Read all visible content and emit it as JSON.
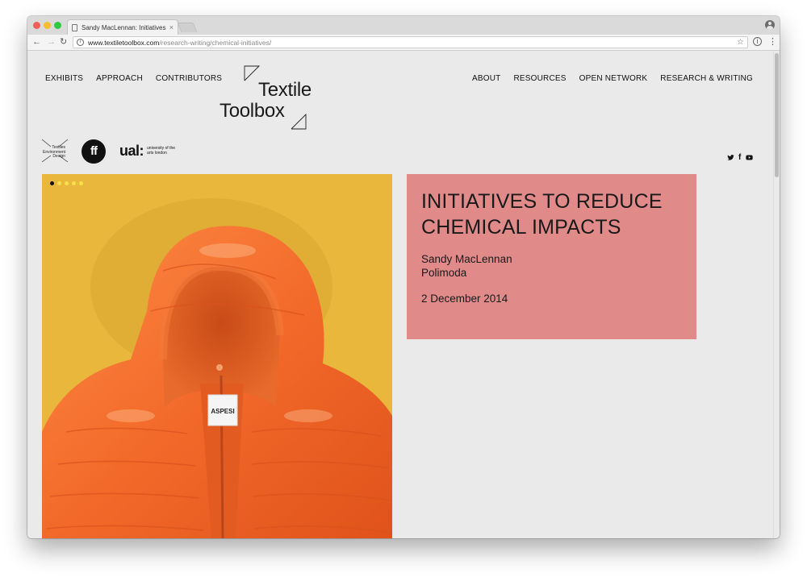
{
  "browser": {
    "tab_title": "Sandy MacLennan: Initiatives t",
    "tab_close": "×",
    "url_host": "www.textiletoolbox.com",
    "url_path": "/research-writing/chemical-initiatives/",
    "back_glyph": "←",
    "forward_glyph": "→",
    "reload_glyph": "↻",
    "info_glyph": "i",
    "star_glyph": "☆",
    "menu_glyph": "⋮"
  },
  "nav": {
    "left": [
      "EXHIBITS",
      "APPROACH",
      "CONTRIBUTORS"
    ],
    "right": [
      "ABOUT",
      "RESOURCES",
      "OPEN NETWORK",
      "RESEARCH & WRITING"
    ]
  },
  "logo": {
    "line1": "Textile",
    "line2": "Toolbox"
  },
  "partners": {
    "ted_text": "Textiles Environment Design",
    "ff_text": "ff",
    "ual_mark": "ual:",
    "ual_text": "university of the arts london"
  },
  "social": {
    "facebook_glyph": "f"
  },
  "hero": {
    "label_text": "ASPESI",
    "slide_count": 5,
    "active_slide": 1,
    "colors": {
      "background": "#e8b73c",
      "jacket": "#f26a2a"
    }
  },
  "article": {
    "title": "INITIATIVES TO REDUCE CHEMICAL IMPACTS",
    "author": "Sandy MacLennan",
    "organization": "Polimoda",
    "date": "2 December 2014",
    "card_color": "#e08a8a"
  },
  "icons": [
    "page-icon",
    "info-icon",
    "star-icon",
    "profile-icon",
    "twitter-icon",
    "facebook-icon",
    "youtube-icon"
  ]
}
